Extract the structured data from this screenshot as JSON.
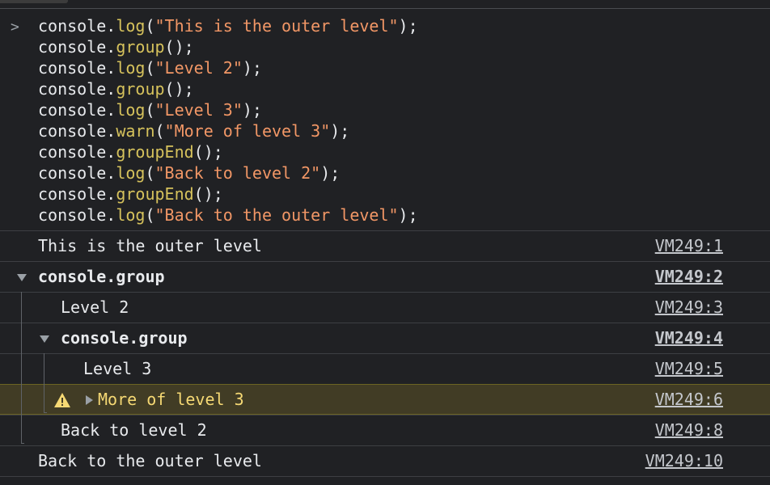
{
  "prompt": ">",
  "code_lines": [
    [
      {
        "t": "console.",
        "c": "obj"
      },
      {
        "t": "log",
        "c": "fn"
      },
      {
        "t": "(",
        "c": "punc"
      },
      {
        "t": "\"This is the outer level\"",
        "c": "str"
      },
      {
        "t": ");",
        "c": "punc"
      }
    ],
    [
      {
        "t": "console.",
        "c": "obj"
      },
      {
        "t": "group",
        "c": "fn"
      },
      {
        "t": "();",
        "c": "punc"
      }
    ],
    [
      {
        "t": "console.",
        "c": "obj"
      },
      {
        "t": "log",
        "c": "fn"
      },
      {
        "t": "(",
        "c": "punc"
      },
      {
        "t": "\"Level 2\"",
        "c": "str"
      },
      {
        "t": ");",
        "c": "punc"
      }
    ],
    [
      {
        "t": "console.",
        "c": "obj"
      },
      {
        "t": "group",
        "c": "fn"
      },
      {
        "t": "();",
        "c": "punc"
      }
    ],
    [
      {
        "t": "console.",
        "c": "obj"
      },
      {
        "t": "log",
        "c": "fn"
      },
      {
        "t": "(",
        "c": "punc"
      },
      {
        "t": "\"Level 3\"",
        "c": "str"
      },
      {
        "t": ");",
        "c": "punc"
      }
    ],
    [
      {
        "t": "console.",
        "c": "obj"
      },
      {
        "t": "warn",
        "c": "fn"
      },
      {
        "t": "(",
        "c": "punc"
      },
      {
        "t": "\"More of level 3\"",
        "c": "str"
      },
      {
        "t": ");",
        "c": "punc"
      }
    ],
    [
      {
        "t": "console.",
        "c": "obj"
      },
      {
        "t": "groupEnd",
        "c": "fn"
      },
      {
        "t": "();",
        "c": "punc"
      }
    ],
    [
      {
        "t": "console.",
        "c": "obj"
      },
      {
        "t": "log",
        "c": "fn"
      },
      {
        "t": "(",
        "c": "punc"
      },
      {
        "t": "\"Back to level 2\"",
        "c": "str"
      },
      {
        "t": ");",
        "c": "punc"
      }
    ],
    [
      {
        "t": "console.",
        "c": "obj"
      },
      {
        "t": "groupEnd",
        "c": "fn"
      },
      {
        "t": "();",
        "c": "punc"
      }
    ],
    [
      {
        "t": "console.",
        "c": "obj"
      },
      {
        "t": "log",
        "c": "fn"
      },
      {
        "t": "(",
        "c": "punc"
      },
      {
        "t": "\"Back to the outer level\"",
        "c": "str"
      },
      {
        "t": ");",
        "c": "punc"
      }
    ]
  ],
  "output": {
    "outer1": {
      "text": "This is the outer level",
      "source": "VM249:1"
    },
    "group1": {
      "text": "console.group",
      "source": "VM249:2"
    },
    "level2": {
      "text": "Level 2",
      "source": "VM249:3"
    },
    "group2": {
      "text": "console.group",
      "source": "VM249:4"
    },
    "level3": {
      "text": "Level 3",
      "source": "VM249:5"
    },
    "warn": {
      "text": "More of level 3",
      "source": "VM249:6",
      "icon": "warning-icon"
    },
    "back2": {
      "text": "Back to level 2",
      "source": "VM249:8"
    },
    "outer2": {
      "text": "Back to the outer level",
      "source": "VM249:10"
    }
  },
  "colors": {
    "background": "#202124",
    "function": "#d6c25c",
    "string": "#f29766",
    "warning_bg": "#413c25",
    "warning_text": "#f6d974"
  }
}
